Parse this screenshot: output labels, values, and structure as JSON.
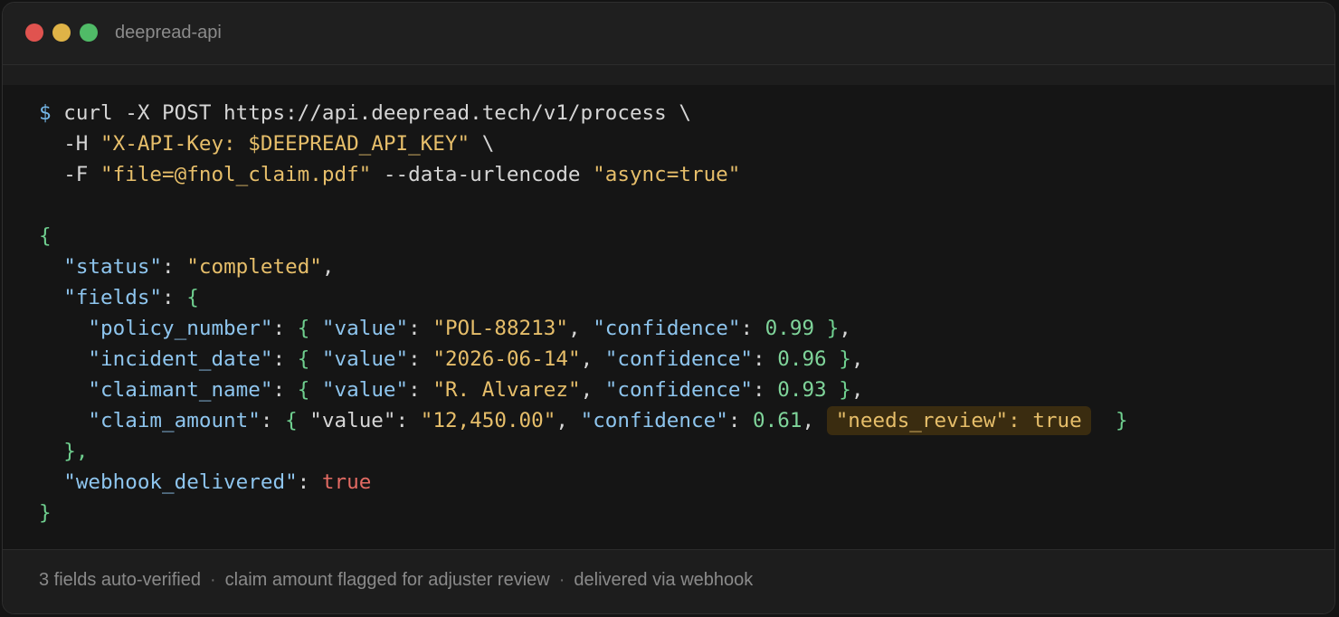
{
  "window": {
    "title": "deepread-api"
  },
  "command": {
    "prompt": "$",
    "line1": "curl -X POST https://api.deepread.tech/v1/process \\",
    "line2_flag": "  -H ",
    "line2_header": "\"X-API-Key: $DEEPREAD_API_KEY\"",
    "line2_cont": " \\",
    "line3_flag": "  -F ",
    "line3_file": "\"file=@fnol_claim.pdf\"",
    "line3_opt": " --data-urlencode ",
    "line3_async": "\"async=true\""
  },
  "response": {
    "open_brace": "{",
    "status_key": "\"status\"",
    "status_value": "\"completed\"",
    "fields_key": "\"fields\"",
    "fields": [
      {
        "name": "\"policy_number\"",
        "value": "\"POL-88213\"",
        "confidence": "0.99"
      },
      {
        "name": "\"incident_date\"",
        "value": "\"2026-06-14\"",
        "confidence": "0.96"
      },
      {
        "name": "\"claimant_name\"",
        "value": "\"R. Alvarez\"",
        "confidence": "0.93"
      },
      {
        "name": "\"claim_amount\"",
        "value": "\"12,450.00\"",
        "confidence": "0.61",
        "flag": "\"needs_review\": true"
      }
    ],
    "value_key": "\"value\"",
    "confidence_key": "\"confidence\"",
    "fields_close": "},",
    "webhook_key": "\"webhook_delivered\"",
    "webhook_value": "true",
    "close_brace": "}"
  },
  "footer": {
    "items": [
      "3 fields auto-verified",
      "claim amount flagged for adjuster review",
      "delivered via webhook"
    ],
    "separator": "·"
  },
  "colors": {
    "string": "#e6be6a",
    "key": "#8ec5ee",
    "brace": "#6fcf8f",
    "boolean": "#e36b63",
    "flag_background": "#3a2c10"
  }
}
